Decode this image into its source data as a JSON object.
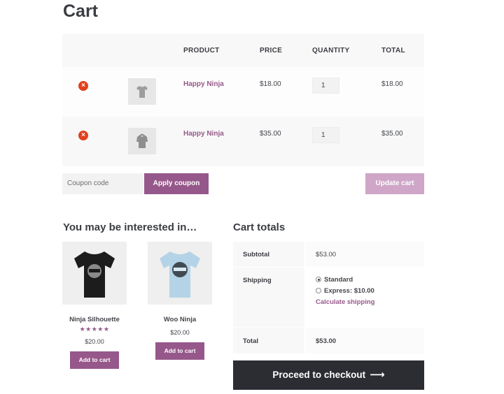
{
  "page": {
    "title": "Cart"
  },
  "cart": {
    "headers": {
      "product": "PRODUCT",
      "price": "PRICE",
      "quantity": "QUANTITY",
      "total": "TOTAL"
    },
    "items": [
      {
        "name": "Happy Ninja",
        "price": "$18.00",
        "quantity": "1",
        "total": "$18.00",
        "thumb_icon": "tshirt-icon"
      },
      {
        "name": "Happy Ninja",
        "price": "$35.00",
        "quantity": "1",
        "total": "$35.00",
        "thumb_icon": "hoodie-icon"
      }
    ],
    "coupon_placeholder": "Coupon code",
    "apply_coupon": "Apply coupon",
    "update_cart": "Update cart"
  },
  "related": {
    "title": "You may be interested in…",
    "products": [
      {
        "name": "Ninja Silhouette",
        "rating": "★★★★★",
        "price": "$20.00",
        "button": "Add to cart",
        "shirt_color": "#1c1c1c"
      },
      {
        "name": "Woo Ninja",
        "price": "$20.00",
        "button": "Add to cart",
        "shirt_color": "#b5d3e6"
      }
    ]
  },
  "totals": {
    "title": "Cart totals",
    "subtotal_label": "Subtotal",
    "subtotal_value": "$53.00",
    "shipping_label": "Shipping",
    "shipping_standard": "Standard",
    "shipping_express": "Express: $10.00",
    "calculate_shipping": "Calculate shipping",
    "total_label": "Total",
    "total_value": "$53.00"
  },
  "checkout": {
    "label": "Proceed to checkout",
    "arrow": "⟶"
  },
  "colors": {
    "accent": "#96588a",
    "remove": "#e2401c",
    "checkout_bg": "#2c2d33"
  }
}
